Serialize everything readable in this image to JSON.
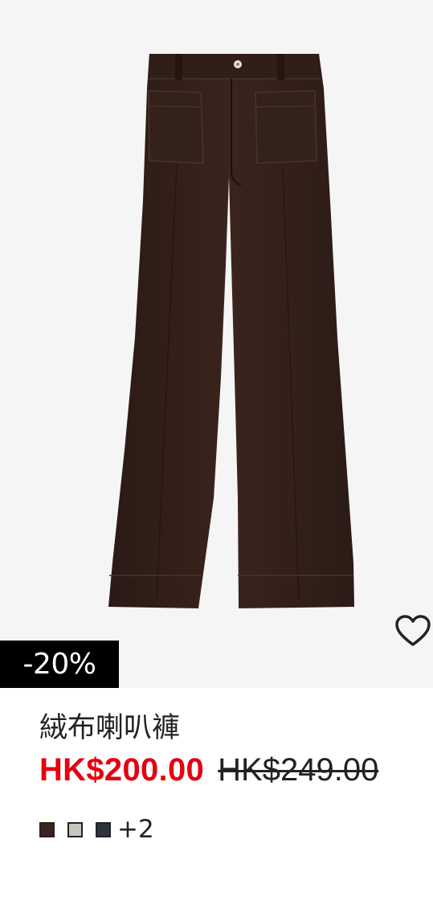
{
  "product": {
    "badge": "-20%",
    "title": "絨布喇叭褲",
    "sale_price": "HK$200.00",
    "original_price": "HK$249.00",
    "image_icon": "corduroy-flare-trousers-image",
    "favorite_icon": "heart-outline-icon",
    "colors": {
      "swatches": [
        "#3b2420",
        "#c8c5bd",
        "#2d3340"
      ],
      "more_label": "+2"
    }
  },
  "theme": {
    "sale_red": "#e50010",
    "badge_bg": "#000000",
    "image_bg": "#f5f5f5"
  }
}
